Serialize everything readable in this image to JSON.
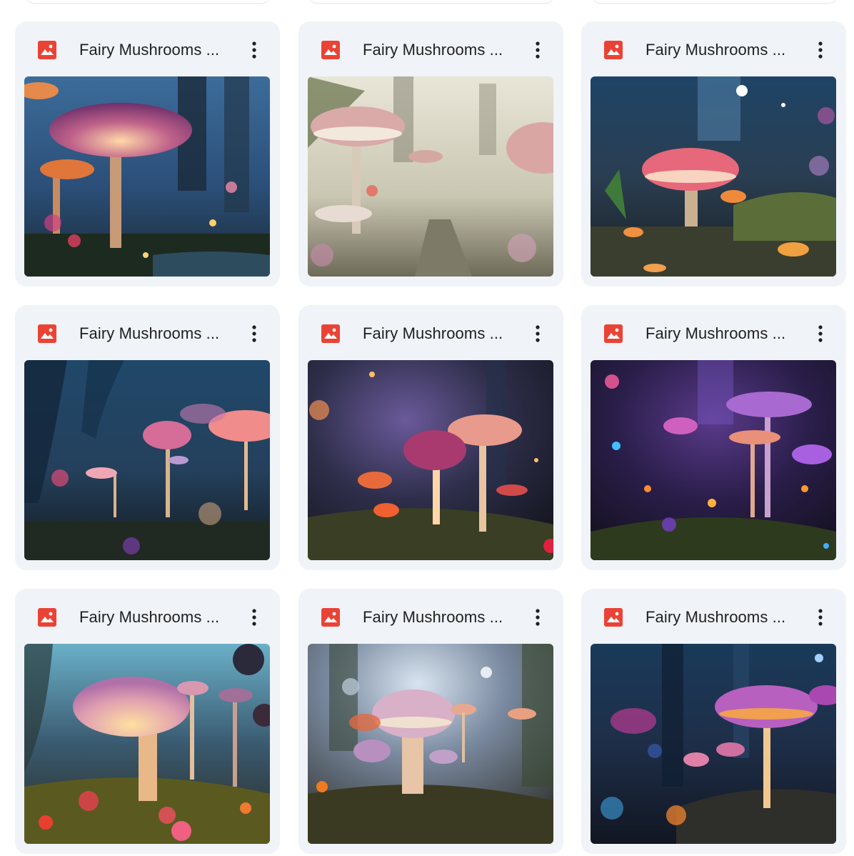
{
  "files": [
    {
      "name": "Fairy Mushrooms ...",
      "icon": "image-file-icon",
      "menu_icon": "more-vert-icon"
    },
    {
      "name": "Fairy Mushrooms ...",
      "icon": "image-file-icon",
      "menu_icon": "more-vert-icon"
    },
    {
      "name": "Fairy Mushrooms ...",
      "icon": "image-file-icon",
      "menu_icon": "more-vert-icon"
    },
    {
      "name": "Fairy Mushrooms ...",
      "icon": "image-file-icon",
      "menu_icon": "more-vert-icon"
    },
    {
      "name": "Fairy Mushrooms ...",
      "icon": "image-file-icon",
      "menu_icon": "more-vert-icon"
    },
    {
      "name": "Fairy Mushrooms ...",
      "icon": "image-file-icon",
      "menu_icon": "more-vert-icon"
    },
    {
      "name": "Fairy Mushrooms ...",
      "icon": "image-file-icon",
      "menu_icon": "more-vert-icon"
    },
    {
      "name": "Fairy Mushrooms ...",
      "icon": "image-file-icon",
      "menu_icon": "more-vert-icon"
    },
    {
      "name": "Fairy Mushrooms ...",
      "icon": "image-file-icon",
      "menu_icon": "more-vert-icon"
    }
  ],
  "colors": {
    "card_bg": "#f0f3f7",
    "image_icon_red": "#ea4335",
    "title_text": "#1f1f1f"
  }
}
